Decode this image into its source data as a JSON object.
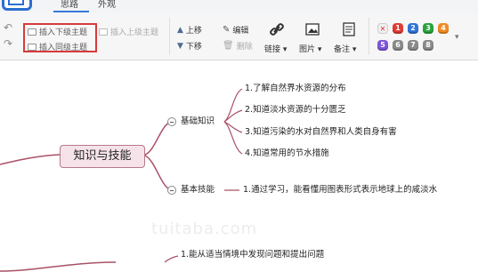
{
  "tabs": [
    "思路",
    "外观"
  ],
  "toolbar": {
    "insert_child": "插入下级主题",
    "insert_parent": "插入上级主题",
    "insert_sibling": "插入同级主题",
    "move_up": "上移",
    "move_down": "下移",
    "edit": "编辑",
    "delete": "删除",
    "link": "链接",
    "image": "图片",
    "note": "备注"
  },
  "priority_tags": [
    "1",
    "2",
    "3",
    "4",
    "5",
    "6",
    "7",
    "8"
  ],
  "tag_colors": {
    "clear": "#d9d9d9",
    "red": "#e23a35",
    "blue": "#2f74d9",
    "green": "#29a33a",
    "orange": "#f08b23",
    "purple": "#7d55d8",
    "grey": "#8a8a8a"
  },
  "mindmap": {
    "central": "知识与技能",
    "branch_basic": "基础知识",
    "branch_skill": "基本技能",
    "items": [
      "1.了解自然界水资源的分布",
      "2.知道淡水资源的十分匮乏",
      "3.知道污染的水对自然界和人类自身有害",
      "4.知道常用的节水措施"
    ],
    "skill_item": "1.通过学习，能看懂用图表形式表示地球上的咸淡水",
    "bottom_item": "1.能从适当情境中发现问题和提出问题"
  },
  "watermark": "tuitaba.com"
}
